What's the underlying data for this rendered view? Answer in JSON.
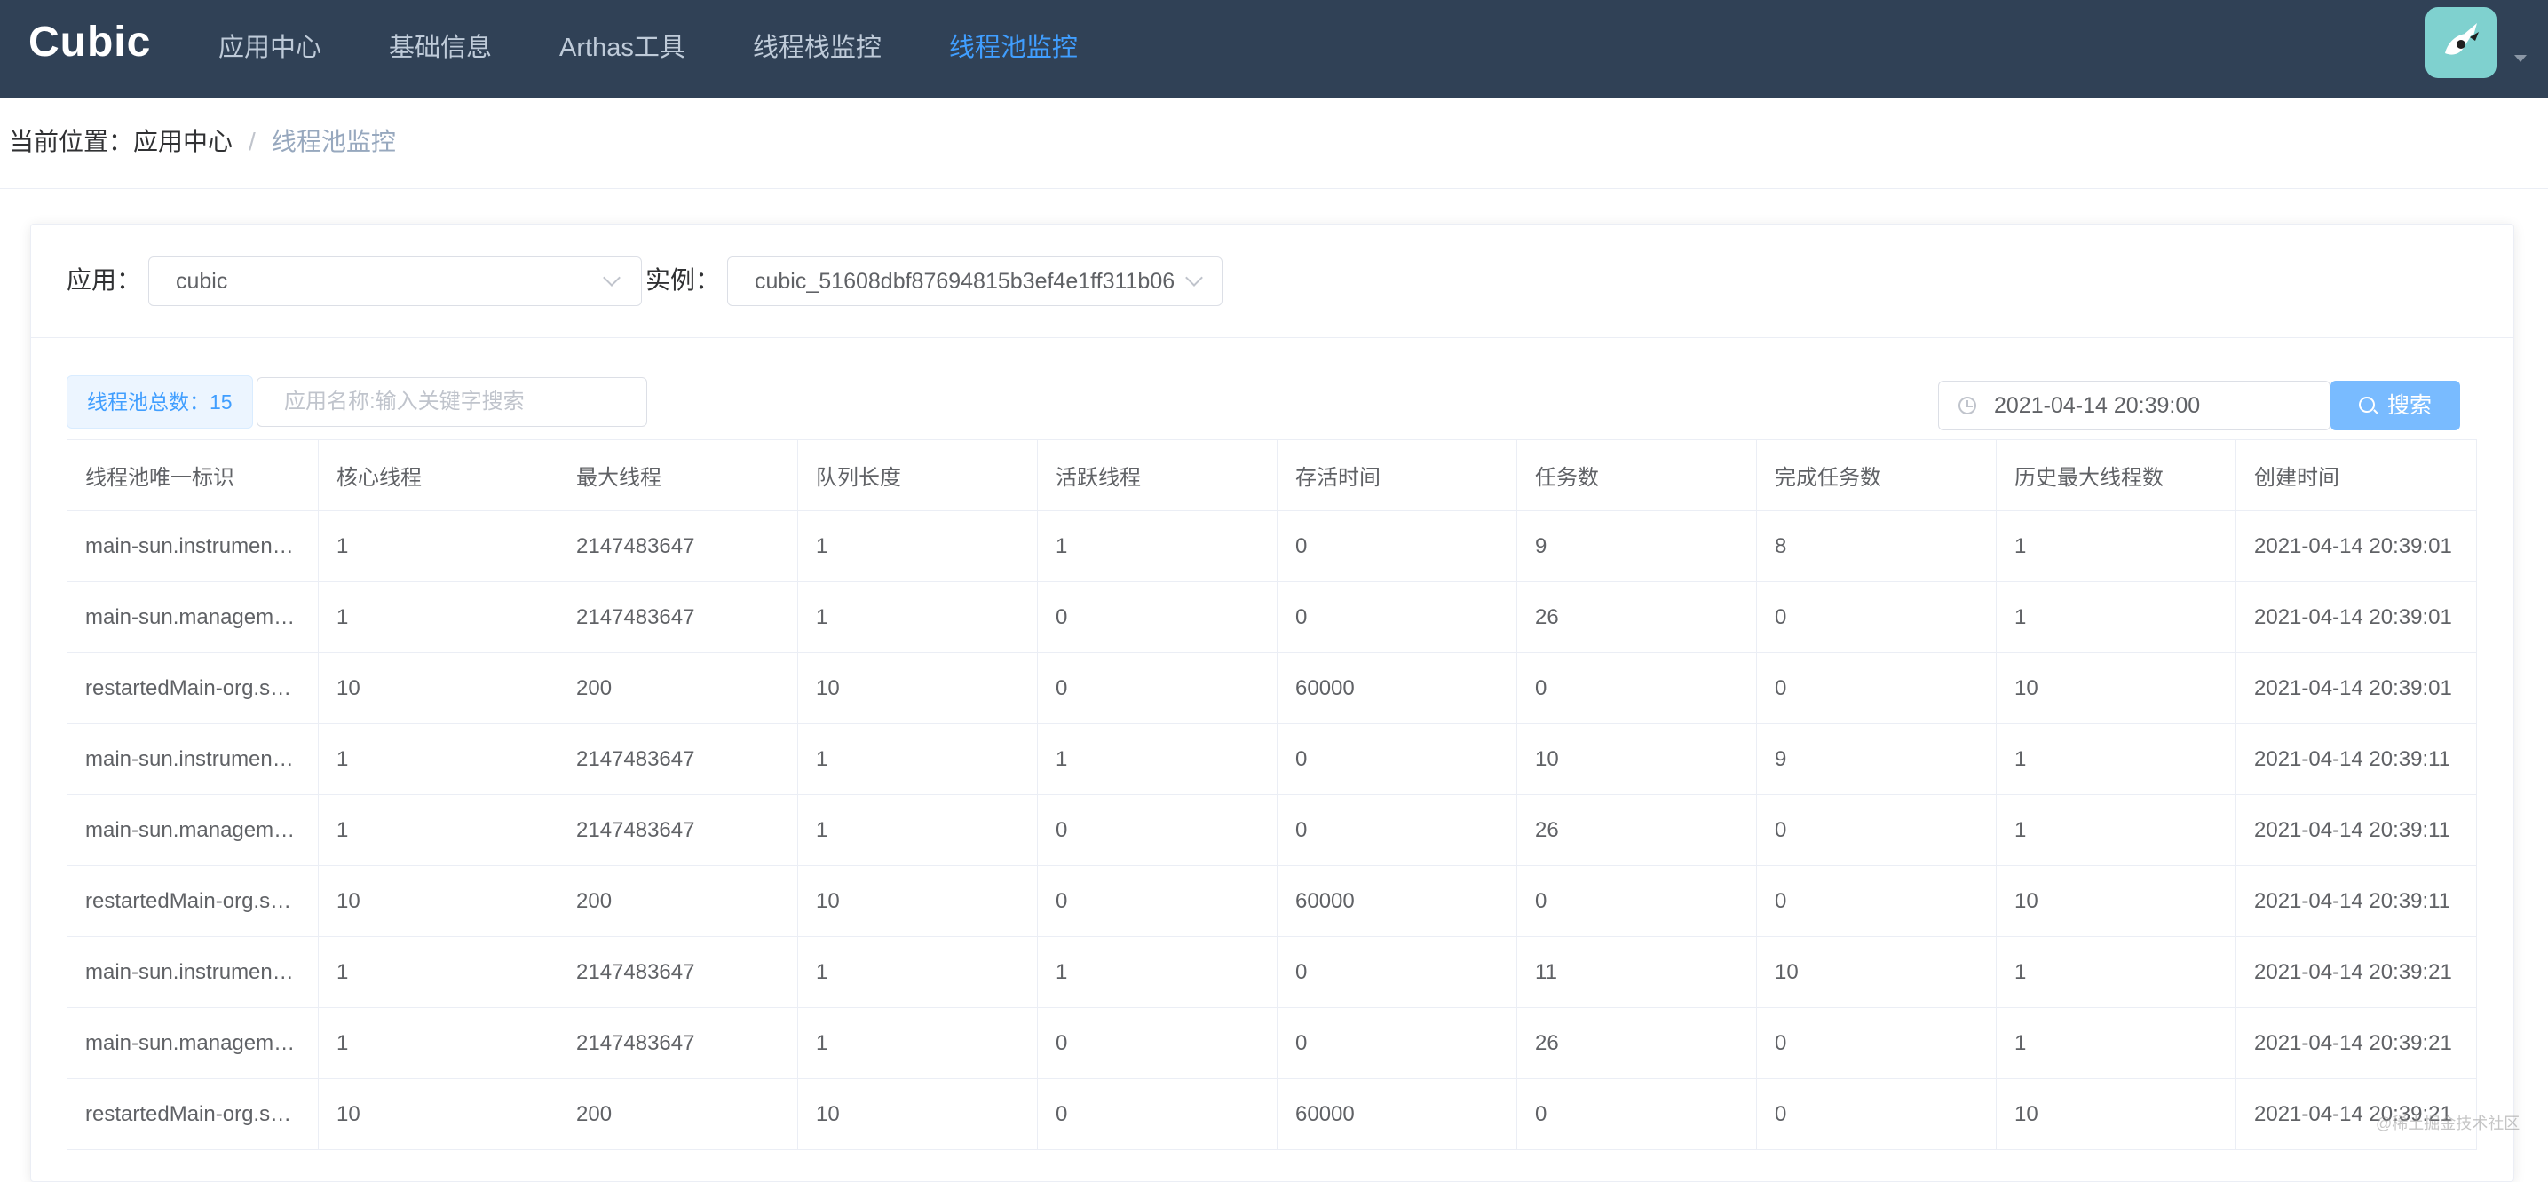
{
  "app": {
    "brand": "Cubic"
  },
  "nav": {
    "items": [
      {
        "label": "应用中心",
        "active": false
      },
      {
        "label": "基础信息",
        "active": false
      },
      {
        "label": "Arthas工具",
        "active": false
      },
      {
        "label": "线程栈监控",
        "active": false
      },
      {
        "label": "线程池监控",
        "active": true
      }
    ]
  },
  "breadcrumb": {
    "prefix": "当前位置：",
    "parent": "应用中心",
    "separator": "/",
    "current": "线程池监控"
  },
  "filters": {
    "app_label": "应用：",
    "app_value": "cubic",
    "instance_label": "实例：",
    "instance_value": "cubic_51608dbf87694815b3ef4e1ff311b06"
  },
  "toolbar": {
    "total_label": "线程池总数：",
    "total_value": "15",
    "search_placeholder": "应用名称:输入关键字搜索",
    "date_value": "2021-04-14 20:39:00",
    "search_button": "搜索"
  },
  "table": {
    "columns": [
      "线程池唯一标识",
      "核心线程",
      "最大线程",
      "队列长度",
      "活跃线程",
      "存活时间",
      "任务数",
      "完成任务数",
      "历史最大线程数",
      "创建时间"
    ],
    "rows": [
      [
        "main-sun.instrumen…",
        "1",
        "2147483647",
        "1",
        "1",
        "0",
        "9",
        "8",
        "1",
        "2021-04-14 20:39:01"
      ],
      [
        "main-sun.managem…",
        "1",
        "2147483647",
        "1",
        "0",
        "0",
        "26",
        "0",
        "1",
        "2021-04-14 20:39:01"
      ],
      [
        "restartedMain-org.s…",
        "10",
        "200",
        "10",
        "0",
        "60000",
        "0",
        "0",
        "10",
        "2021-04-14 20:39:01"
      ],
      [
        "main-sun.instrumen…",
        "1",
        "2147483647",
        "1",
        "1",
        "0",
        "10",
        "9",
        "1",
        "2021-04-14 20:39:11"
      ],
      [
        "main-sun.managem…",
        "1",
        "2147483647",
        "1",
        "0",
        "0",
        "26",
        "0",
        "1",
        "2021-04-14 20:39:11"
      ],
      [
        "restartedMain-org.s…",
        "10",
        "200",
        "10",
        "0",
        "60000",
        "0",
        "0",
        "10",
        "2021-04-14 20:39:11"
      ],
      [
        "main-sun.instrumen…",
        "1",
        "2147483647",
        "1",
        "1",
        "0",
        "11",
        "10",
        "1",
        "2021-04-14 20:39:21"
      ],
      [
        "main-sun.managem…",
        "1",
        "2147483647",
        "1",
        "0",
        "0",
        "26",
        "0",
        "1",
        "2021-04-14 20:39:21"
      ],
      [
        "restartedMain-org.s…",
        "10",
        "200",
        "10",
        "0",
        "60000",
        "0",
        "0",
        "10",
        "2021-04-14 20:39:21"
      ]
    ]
  },
  "watermark": "@稀土掘金技术社区"
}
